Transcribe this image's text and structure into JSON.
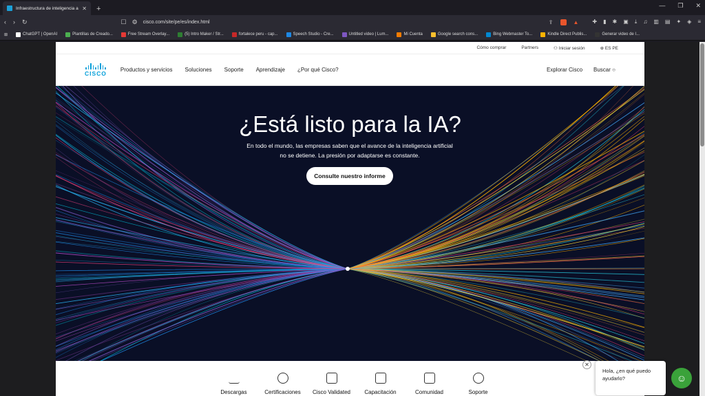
{
  "browser": {
    "tab_title": "Infraestructura de inteligencia ar",
    "url": "cisco.com/site/pe/es/index.html",
    "bookmarks": [
      {
        "label": "ChatGPT | OpenAI",
        "color": "#ffffff"
      },
      {
        "label": "Plantillas de Creado...",
        "color": "#4caf50"
      },
      {
        "label": "Free Stream Overlay...",
        "color": "#e53935"
      },
      {
        "label": "(5) Intro Maker / Str...",
        "color": "#2e7d32"
      },
      {
        "label": "fortalece peru - cap...",
        "color": "#c62828"
      },
      {
        "label": "Speech Studio - Cre...",
        "color": "#1e88e5"
      },
      {
        "label": "Untitled video | Lum...",
        "color": "#7e57c2"
      },
      {
        "label": "Mi Cuenta",
        "color": "#f57c00"
      },
      {
        "label": "Google search cons...",
        "color": "#fbc02d"
      },
      {
        "label": "Bing Webmaster To...",
        "color": "#0288d1"
      },
      {
        "label": "Kindle Direct Publis...",
        "color": "#ffb300"
      },
      {
        "label": "Generar video de I...",
        "color": "#333333"
      }
    ]
  },
  "utility_nav": [
    "Cómo comprar",
    "Partners",
    "Iniciar sesión",
    "ES PE"
  ],
  "nav": {
    "logo": "CISCO",
    "links": [
      "Productos y servicios",
      "Soluciones",
      "Soporte",
      "Aprendizaje",
      "¿Por qué Cisco?"
    ],
    "explore": "Explorar Cisco",
    "search": "Buscar"
  },
  "hero": {
    "title": "¿Está listo para la IA?",
    "subtitle": "En todo el mundo, las empresas saben que el avance de la inteligencia artificial no se detiene. La presión por adaptarse es constante.",
    "cta": "Consulte nuestro informe"
  },
  "tools": [
    "Descargas",
    "Certificaciones",
    "Cisco Validated",
    "Capacitación",
    "Comunidad",
    "Soporte"
  ],
  "chat": {
    "message": "Hola, ¿en qué puedo ayudarlo?"
  },
  "colors": {
    "accent": "#049fd9",
    "hero_bg": "#0a0f26",
    "chat_bot": "#3aa23a"
  }
}
